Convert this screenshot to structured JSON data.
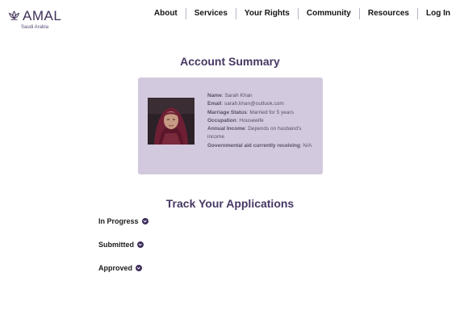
{
  "brand": {
    "name": "AMAL",
    "subtitle": "Saudi Arabia",
    "logo_icon": "lotus-icon"
  },
  "nav": {
    "items": [
      {
        "label": "About"
      },
      {
        "label": "Services"
      },
      {
        "label": "Your Rights"
      },
      {
        "label": "Community"
      },
      {
        "label": "Resources"
      },
      {
        "label": "Log In"
      }
    ]
  },
  "summary": {
    "title": "Account Summary",
    "fields": [
      {
        "label": "Name",
        "value": "Sarah Khan"
      },
      {
        "label": "Email",
        "value": "sarah.khan@outlook.com"
      },
      {
        "label": "Marriage Status",
        "value": "Married for 5 years"
      },
      {
        "label": "Occupation",
        "value": "Housewife"
      },
      {
        "label": "Annual Income",
        "value": "Depends on husband's income"
      },
      {
        "label": "Governmental aid currently receiving",
        "value": "N/A"
      }
    ]
  },
  "applications": {
    "title": "Track Your Applications",
    "statuses": [
      {
        "label": "In Progress",
        "icon": "chevron-down-icon"
      },
      {
        "label": "Submitted",
        "icon": "chevron-down-icon"
      },
      {
        "label": "Approved",
        "icon": "chevron-down-icon"
      }
    ]
  },
  "colors": {
    "brand": "#3f3158",
    "card_background": "#d3c9de",
    "accent": "#473763"
  }
}
